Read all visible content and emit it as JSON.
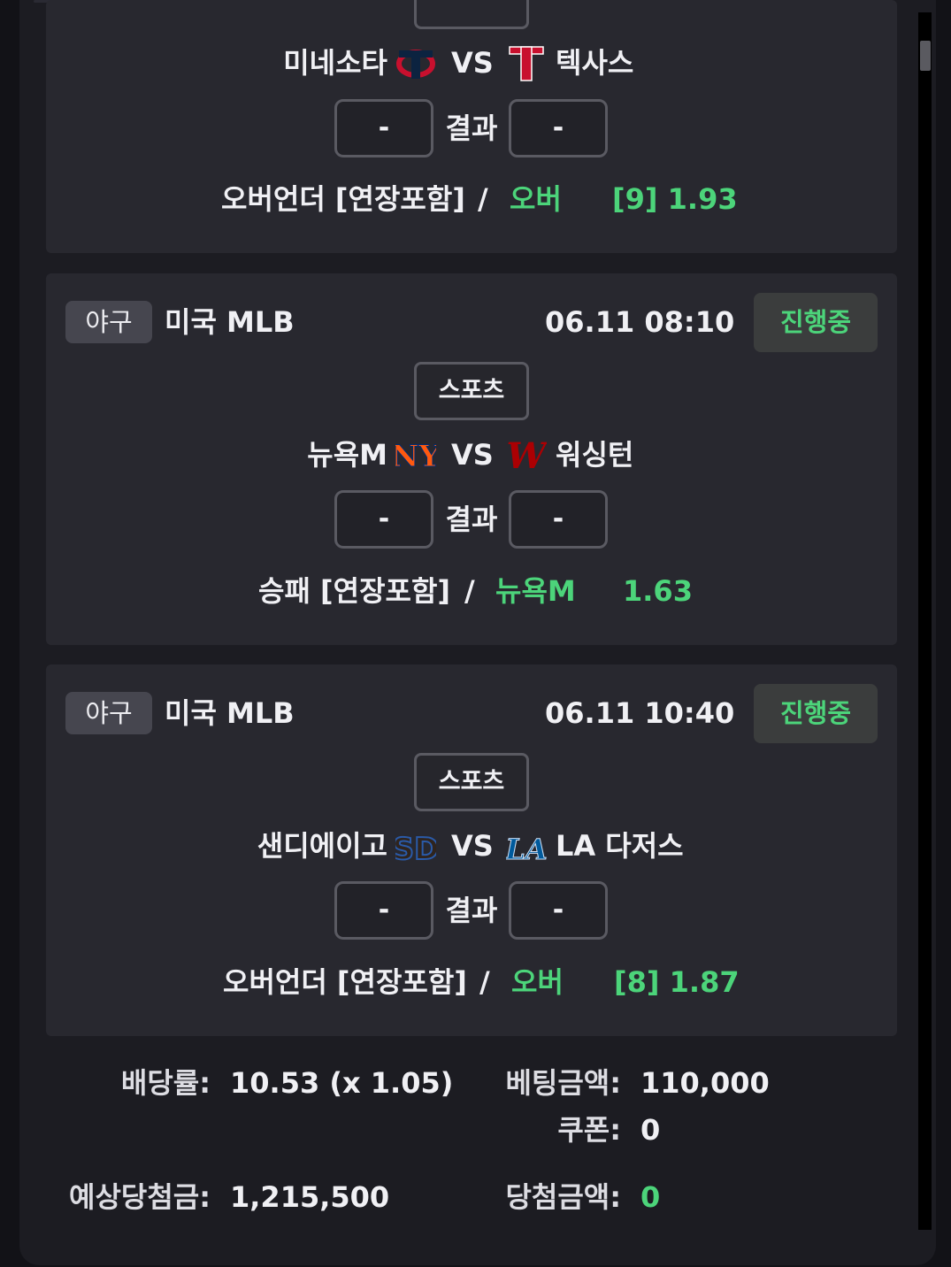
{
  "colors": {
    "accent_green": "#4cd47a",
    "card_bg": "#28282f",
    "panel_bg": "#1c1c22"
  },
  "games": [
    {
      "home": "미네소타",
      "home_icon": "twins-logo-icon",
      "vs": "VS",
      "away": "텍사스",
      "away_icon": "rangers-logo-icon",
      "home_score": "-",
      "result_label": "결과",
      "away_score": "-",
      "market": "오버언더 [연장포함]",
      "separator": "/",
      "pick": "오버",
      "odds": "[9] 1.93"
    },
    {
      "sport": "야구",
      "league": "미국 MLB",
      "datetime": "06.11 08:10",
      "status": "진행중",
      "category": "스포츠",
      "home": "뉴욕M",
      "home_icon": "mets-logo-icon",
      "vs": "VS",
      "away": "워싱턴",
      "away_icon": "nationals-logo-icon",
      "home_score": "-",
      "result_label": "결과",
      "away_score": "-",
      "market": "승패 [연장포함]",
      "separator": "/",
      "pick": "뉴욕M",
      "odds": "1.63"
    },
    {
      "sport": "야구",
      "league": "미국 MLB",
      "datetime": "06.11 10:40",
      "status": "진행중",
      "category": "스포츠",
      "home": "샌디에이고",
      "home_icon": "padres-logo-icon",
      "vs": "VS",
      "away": "LA 다저스",
      "away_icon": "dodgers-logo-icon",
      "home_score": "-",
      "result_label": "결과",
      "away_score": "-",
      "market": "오버언더 [연장포함]",
      "separator": "/",
      "pick": "오버",
      "odds": "[8] 1.87"
    }
  ],
  "summary": {
    "odds_label": "배당률:",
    "odds_value": "10.53 (x 1.05)",
    "bet_amount_label": "베팅금액:",
    "bet_amount_value": "110,000",
    "coupon_label": "쿠폰:",
    "coupon_value": "0",
    "expected_win_label": "예상당첨금:",
    "expected_win_value": "1,215,500",
    "win_amount_label": "당첨금액:",
    "win_amount_value": "0"
  }
}
